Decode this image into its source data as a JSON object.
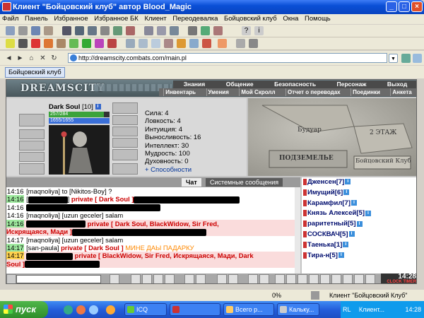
{
  "window": {
    "title": "Клиент \"Бойцовский клуб\" автор Blood_Magic"
  },
  "menu": [
    "Файл",
    "Панель",
    "Избранное",
    "Избранное БК",
    "Клиент",
    "Переодевалка",
    "Бойцовский клуб",
    "Окна",
    "Помощь"
  ],
  "address": {
    "url": "http://dreamscity.combats.com/main.pl"
  },
  "tab": {
    "label": "Бойцовский клуб"
  },
  "game": {
    "logo": "DREAMSCITY",
    "nav_top": [
      "Знания",
      "Общение",
      "Безопасность",
      "Персонаж",
      "Выход"
    ],
    "nav_bottom": [
      "Инвентарь",
      "Умения",
      "Мой Скролл",
      "Отчет о переводах",
      "Поединки",
      "Анкета"
    ],
    "player": {
      "name": "Dark Soul",
      "level": "[10]",
      "hp": "257/284",
      "mp": "1655/1655",
      "hp_fraction": 0.905
    },
    "stats": [
      "Сила: 4",
      "Ловкость: 4",
      "Интуиция: 4",
      "Выносливость: 16",
      "Интеллект: 30",
      "Мудрость: 100",
      "Духовность: 0"
    ],
    "stats_more": "+ Способности",
    "map": {
      "label1": "Будуар",
      "label2": "2 ЭТАЖ",
      "label3": "ПОДЗЕМЕЛЬЕ",
      "label4": "Бойцовский Клуб"
    },
    "chat_tabs": [
      "Чат",
      "Системные сообщения"
    ],
    "chat": [
      {
        "time": "14:16",
        "parts": [
          {
            "c": "n",
            "t": "[maqnoliya]"
          },
          {
            "c": "x",
            "t": " to [Nikitos-Boy] ?"
          }
        ]
      },
      {
        "time": "14:16",
        "style": "g",
        "parts": [
          {
            "c": "n",
            "t": "["
          },
          {
            "c": "r",
            "w": 56
          },
          {
            "c": "n",
            "t": "]"
          },
          {
            "c": "p",
            "t": " private [ Dark Soul ]"
          },
          {
            "c": "r",
            "w": 150
          }
        ]
      },
      {
        "time": "14:16",
        "parts": [
          {
            "c": "r",
            "w": 190
          }
        ]
      },
      {
        "time": "14:16",
        "parts": [
          {
            "c": "n",
            "t": "[maqnoliya]"
          },
          {
            "c": "x",
            "t": " [uzun geceler] salam"
          }
        ]
      },
      {
        "time": "14:16",
        "style": "g",
        "hl": true,
        "parts": [
          {
            "c": "r",
            "w": 84
          },
          {
            "c": "p",
            "t": " private [ Dark Soul, BlackWidow, Sir Fred,"
          }
        ]
      },
      {
        "time": "",
        "hl": true,
        "parts": [
          {
            "c": "p",
            "t": "Искрящаяся, Мади ]"
          },
          {
            "c": "r",
            "w": 190
          }
        ]
      },
      {
        "time": "14:17",
        "parts": [
          {
            "c": "n",
            "t": "[maqnoliya]"
          },
          {
            "c": "x",
            "t": " [uzun geceler] salam"
          }
        ]
      },
      {
        "time": "14:17",
        "style": "g",
        "parts": [
          {
            "c": "n",
            "t": "[san-paula]"
          },
          {
            "c": "p",
            "t": " private [ Dark Soul ]"
          },
          {
            "c": "o",
            "t": " МИНЕ ДАЫ ПАДАРКУ"
          }
        ]
      },
      {
        "time": "14:17",
        "style": "g2",
        "hl": true,
        "parts": [
          {
            "c": "r",
            "w": 66
          },
          {
            "c": "p",
            "t": " private [ BlackWidow, Sir Fred, Искрящаяся, Мади, Dark"
          }
        ]
      },
      {
        "time": "",
        "hl": true,
        "parts": [
          {
            "c": "p",
            "t": "Soul ]"
          },
          {
            "c": "r",
            "w": 106
          }
        ]
      }
    ],
    "users": [
      {
        "name": "Дженсен",
        "lvl": "[7]"
      },
      {
        "name": "Имущий",
        "lvl": "[6]"
      },
      {
        "name": "Карамфил",
        "lvl": "[7]"
      },
      {
        "name": "Князь Алексей",
        "lvl": "[5]"
      },
      {
        "name": "раритетный",
        "lvl": "[5]"
      },
      {
        "name": "СОСКВАЧ",
        "lvl": "[5]"
      },
      {
        "name": "Таенька",
        "lvl": "[1]"
      },
      {
        "name": "Тира-н",
        "lvl": "[5]"
      }
    ],
    "clock": {
      "time": "14:28",
      "labels": "CLOCK TIMER"
    }
  },
  "status": {
    "percent": "0%",
    "client": "Клиент \"Бойцовский Клуб\""
  },
  "taskbar": {
    "start": "пуск",
    "tasks": [
      "ICQ",
      "Всего р...",
      "Кальку...",
      "Клиент..."
    ],
    "tray_time": "14:28",
    "lang": "RL"
  }
}
